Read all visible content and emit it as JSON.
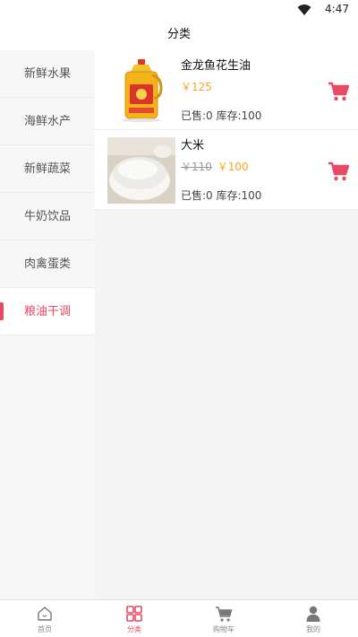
{
  "status": {
    "time": "4:47"
  },
  "header": {
    "title": "分类"
  },
  "sidebar": {
    "items": [
      {
        "label": "新鲜水果"
      },
      {
        "label": "海鲜水产"
      },
      {
        "label": "新鲜蔬菜"
      },
      {
        "label": "牛奶饮品"
      },
      {
        "label": "肉禽蛋类"
      },
      {
        "label": "粮油干调",
        "active": true
      }
    ]
  },
  "products": [
    {
      "name": "金龙鱼花生油",
      "old_price": "",
      "price": "￥125",
      "stats": "已售:0 库存:100"
    },
    {
      "name": "大米",
      "old_price": "￥110",
      "price": "￥100",
      "stats": "已售:0 库存:100"
    }
  ],
  "tabs": [
    {
      "label": "首页",
      "icon": "home-icon"
    },
    {
      "label": "分类",
      "icon": "category-grid-icon",
      "active": true
    },
    {
      "label": "购物车",
      "icon": "cart-icon"
    },
    {
      "label": "我的",
      "icon": "user-icon"
    }
  ],
  "colors": {
    "accent": "#e84a63",
    "price": "#f5a623",
    "sidebar_bg": "#f7f7f7",
    "content_bg": "#f4f4f4"
  }
}
